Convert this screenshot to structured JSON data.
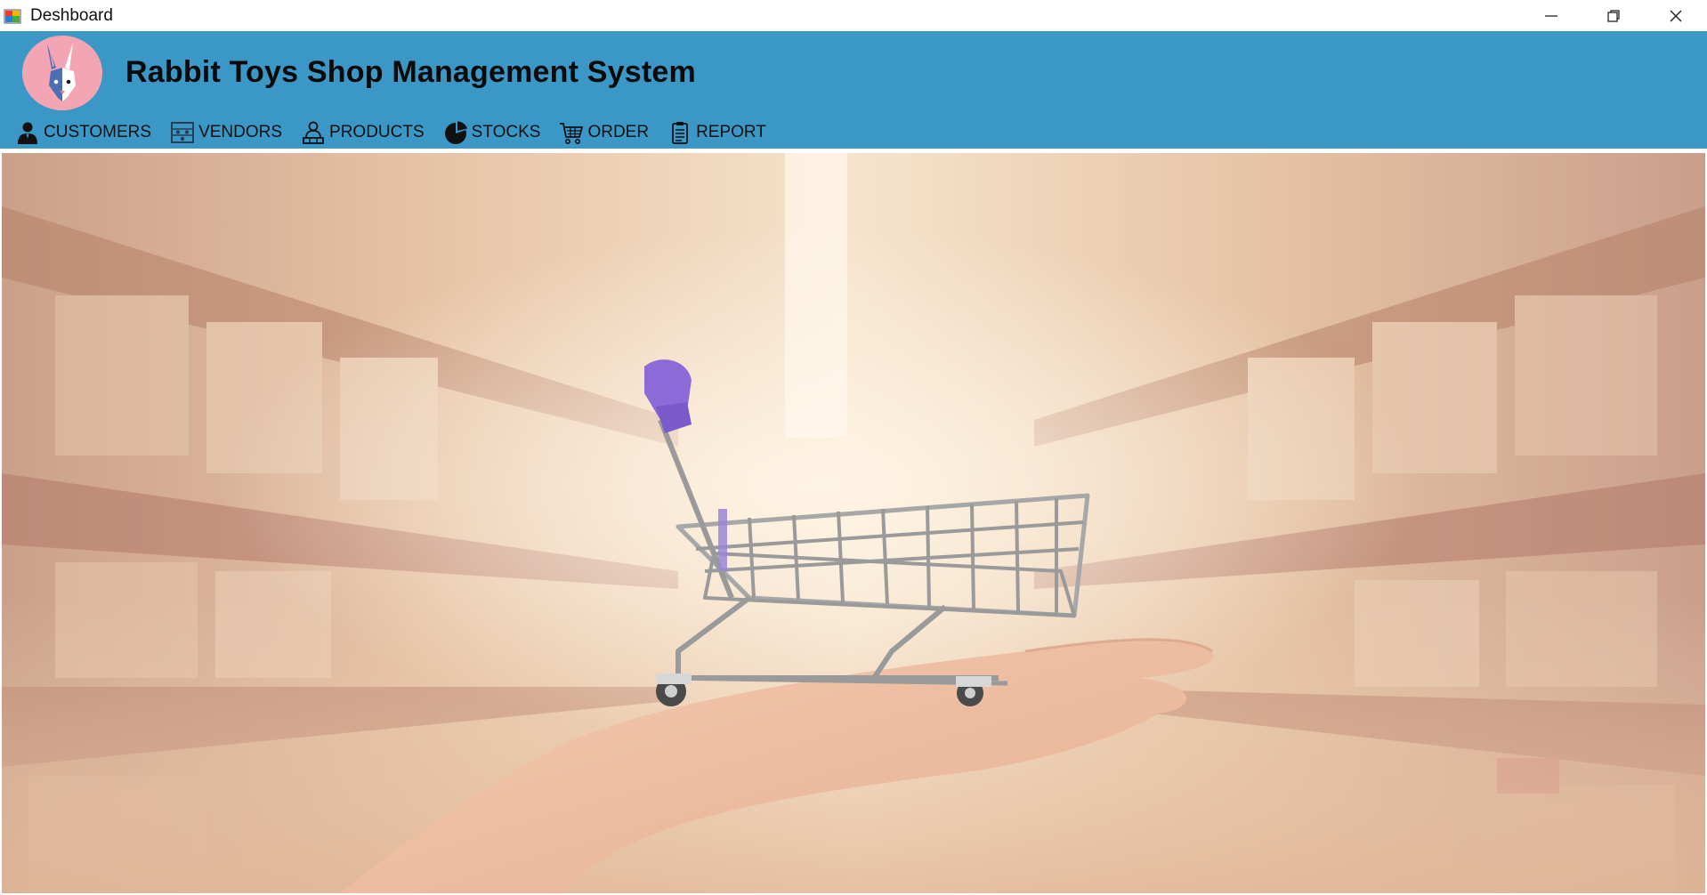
{
  "window": {
    "title": "Deshboard",
    "icon": "app-window-icon",
    "controls": [
      "minimize-icon",
      "restore-icon",
      "close-icon"
    ]
  },
  "header": {
    "logo": "rabbit-logo",
    "title": "Rabbit Toys Shop Management System",
    "background_color": "#3b97c6"
  },
  "menu": {
    "items": [
      {
        "label": "CUSTOMERS",
        "icon": "customer-icon"
      },
      {
        "label": "VENDORS",
        "icon": "vendors-icon"
      },
      {
        "label": "PRODUCTS",
        "icon": "products-icon"
      },
      {
        "label": "STOCKS",
        "icon": "stocks-pie-icon"
      },
      {
        "label": "ORDER",
        "icon": "cart-icon"
      },
      {
        "label": "REPORT",
        "icon": "clipboard-icon"
      }
    ]
  },
  "content": {
    "image": "warehouse-shopping-cart-on-hand-photo"
  }
}
